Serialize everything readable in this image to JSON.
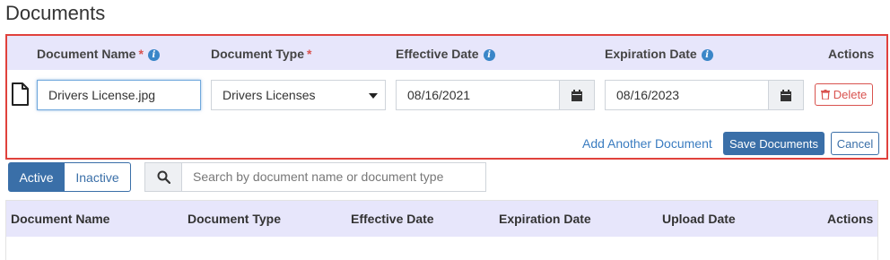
{
  "page_title": "Documents",
  "upload_form": {
    "headers": {
      "document_name": "Document Name",
      "document_type": "Document Type",
      "effective_date": "Effective Date",
      "expiration_date": "Expiration Date",
      "actions": "Actions",
      "required_mark": "*"
    },
    "row": {
      "file_name": "Drivers License.jpg",
      "document_type": "Drivers Licenses",
      "effective_date": "08/16/2021",
      "expiration_date": "08/16/2023",
      "delete_label": "Delete"
    },
    "add_another_label": "Add Another Document",
    "save_label": "Save Documents",
    "cancel_label": "Cancel"
  },
  "filter": {
    "active_label": "Active",
    "inactive_label": "Inactive",
    "selected": "Active"
  },
  "search": {
    "placeholder": "Search by document name or document type"
  },
  "table": {
    "columns": [
      "Document Name",
      "Document Type",
      "Effective Date",
      "Expiration Date",
      "Upload Date",
      "Actions"
    ]
  },
  "colors": {
    "accent": "#3a6fa8",
    "header_bg": "#e7e6fb",
    "highlight_border": "#e0413c",
    "danger": "#d9534f",
    "info": "#3a86c8"
  }
}
